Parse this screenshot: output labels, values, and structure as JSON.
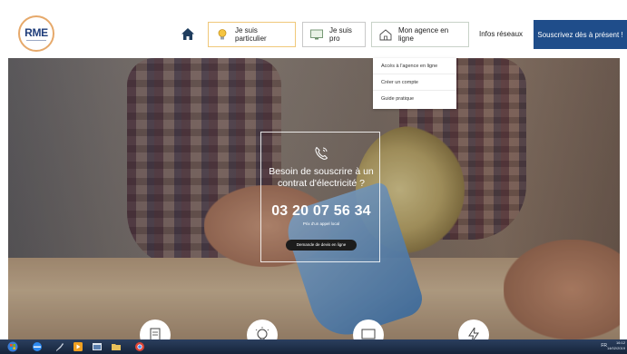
{
  "header": {
    "logo_text": "RME",
    "nav": {
      "particulier": "Je suis particulier",
      "pro": "Je suis pro",
      "agence": "Mon agence en ligne",
      "infos": "Infos réseaux"
    },
    "cta_label": "Souscrivez dès à présent !"
  },
  "dropdown": {
    "items": [
      "Accès à l'agence en ligne",
      "Créer un compte",
      "Guide pratique"
    ]
  },
  "card": {
    "title": "Besoin de souscrire à un contrat d'électricité ?",
    "phone": "03 20 07 56 34",
    "subtitle": "Prix d'un appel local",
    "button_label": "Demande de devis en ligne"
  },
  "taskbar": {
    "tray_text": "FR",
    "clock_time": "16:12",
    "clock_date": "14/02/2019"
  },
  "colors": {
    "accent_blue": "#1f4d8a",
    "logo_ring": "#e6a96b",
    "card_button": "#1c1c1c"
  },
  "icons": [
    "home-icon",
    "lightbulb-icon",
    "monitor-icon",
    "house-icon",
    "phone-icon",
    "document-icon",
    "bulb-circle-icon",
    "screen-circle-icon",
    "lightning-icon"
  ]
}
